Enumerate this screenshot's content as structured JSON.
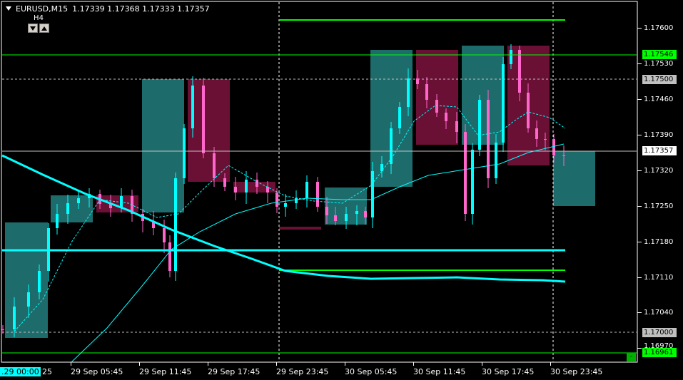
{
  "header": {
    "symbol_tf": "EURUSD,M15",
    "ohlc": "1.17339 1.17368 1.17333 1.17357",
    "timeframe_box": "H4"
  },
  "price_axis": {
    "ticks": [
      "1.17600",
      "1.17530",
      "1.17460",
      "1.17390",
      "1.17320",
      "1.17250",
      "1.17180",
      "1.17110",
      "1.17040",
      "1.16970"
    ],
    "price_labels": [
      {
        "text": "1.17546",
        "kind": "level",
        "color": "#00ff00"
      },
      {
        "text": "1.17500",
        "kind": "hline",
        "color": "#c0c0c0"
      },
      {
        "text": "1.17357",
        "kind": "bid",
        "color": "#ffffff"
      },
      {
        "text": "1.17000",
        "kind": "hline",
        "color": "#c0c0c0"
      },
      {
        "text": "1.16961",
        "kind": "level",
        "color": "#00ff00"
      }
    ]
  },
  "time_axis": {
    "labels": [
      "29 Sep 05:45",
      "29 Sep 11:45",
      "29 Sep 17:45",
      "29 Sep 23:45",
      "30 Sep 05:45",
      "30 Sep 11:45",
      "30 Sep 17:45",
      "30 Sep 23:45"
    ],
    "cursor_label": ".29 00:00",
    "cursor_suffix": "25"
  },
  "colors": {
    "background": "#000000",
    "bull_candle": "#00ffff",
    "bear_candle": "#ff66cc",
    "h4_bull_box": "#1e6b6b",
    "h4_bear_box": "#6b1035",
    "level_line": "#00ff00",
    "ma_line": "#00ffff"
  },
  "corner_button": "-"
}
